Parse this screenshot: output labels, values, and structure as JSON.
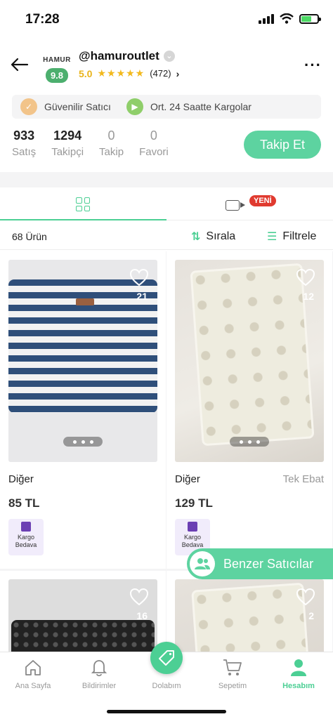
{
  "status": {
    "time": "17:28"
  },
  "store": {
    "logo_text": "HAMUR",
    "score": "9.8",
    "handle": "@hamuroutlet",
    "rating": "5.0",
    "stars": "★★★★★",
    "review_count": "(472)"
  },
  "badges": [
    {
      "label": "Güvenilir Satıcı",
      "icon": "shield-check-icon",
      "color": "#f2c48a"
    },
    {
      "label": "Ort. 24 Saatte Kargolar",
      "icon": "truck-icon",
      "color": "#8fce6a"
    }
  ],
  "stats": [
    {
      "value": "933",
      "label": "Satış"
    },
    {
      "value": "1294",
      "label": "Takipçi"
    },
    {
      "value": "0",
      "label": "Takip"
    },
    {
      "value": "0",
      "label": "Favori"
    }
  ],
  "follow_label": "Takip Et",
  "tabs": {
    "new_badge": "YENİ"
  },
  "toolbar": {
    "count": "68 Ürün",
    "sort": "Sırala",
    "filter": "Filtrele"
  },
  "products": [
    {
      "category": "Diğer",
      "size": "",
      "price": "85 TL",
      "favorites": "21",
      "cargo": "Kargo Bedava"
    },
    {
      "category": "Diğer",
      "size": "Tek Ebat",
      "price": "129 TL",
      "favorites": "12",
      "cargo": "Kargo Bedava"
    },
    {
      "favorites": "16"
    },
    {
      "favorites": "2"
    }
  ],
  "similar_sellers": "Benzer Satıcılar",
  "nav": {
    "home": "Ana Sayfa",
    "notifications": "Bildirimler",
    "wardrobe": "Dolabım",
    "cart": "Sepetim",
    "account": "Hesabım"
  },
  "colors": {
    "accent": "#4ccf94",
    "rating": "#e9b41a",
    "new_badge": "#e03a2f",
    "cargo": "#6b3fb3"
  }
}
